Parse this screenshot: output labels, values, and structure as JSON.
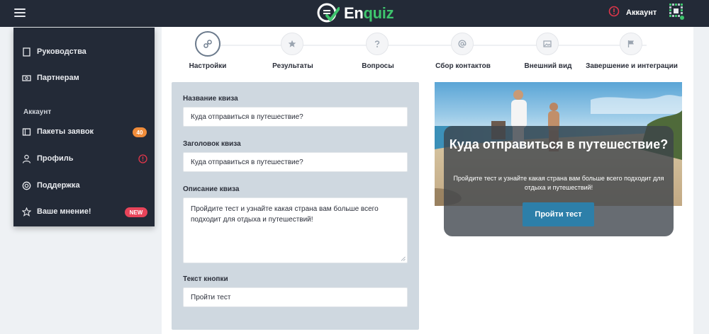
{
  "topbar": {
    "logo_prefix": "En",
    "logo_suffix": "quiz",
    "account_label": "Аккаунт"
  },
  "sidebar": {
    "items": [
      {
        "label": "Руководства",
        "icon": "document-icon"
      },
      {
        "label": "Партнерам",
        "icon": "money-icon"
      }
    ],
    "section_title": "Аккаунт",
    "account_items": [
      {
        "label": "Пакеты заявок",
        "icon": "package-icon",
        "badge": "40"
      },
      {
        "label": "Профиль",
        "icon": "user-icon",
        "badge_icon": "alert-icon"
      },
      {
        "label": "Поддержка",
        "icon": "lifebuoy-icon"
      },
      {
        "label": "Ваше мнение!",
        "icon": "star-icon",
        "badge": "NEW"
      }
    ]
  },
  "stepper": {
    "steps": [
      {
        "label": "Настройки",
        "icon": "link-icon",
        "active": true
      },
      {
        "label": "Результаты",
        "icon": "star-icon",
        "active": false
      },
      {
        "label": "Вопросы",
        "icon": "question-icon",
        "active": false
      },
      {
        "label": "Сбор контактов",
        "icon": "at-icon",
        "active": false
      },
      {
        "label": "Внешний вид",
        "icon": "image-icon",
        "active": false
      },
      {
        "label": "Завершение и интеграции",
        "icon": "flag-icon",
        "active": false
      }
    ]
  },
  "form": {
    "quiz_name_label": "Название квиза",
    "quiz_name_value": "Куда отправиться в путешествие?",
    "quiz_heading_label": "Заголовок квиза",
    "quiz_heading_value": "Куда отправиться в путешествие?",
    "quiz_description_label": "Описание квиза",
    "quiz_description_value": "Пройдите тест и узнайте какая страна вам больше всего подходит для отдыха и путешествий!",
    "button_text_label": "Текст кнопки",
    "button_text_value": "Пройти тест"
  },
  "preview": {
    "title": "Куда отправиться в путешествие?",
    "description": "Пройдите тест и узнайте какая страна вам больше всего подходит для отдыха и путешествий!",
    "button_label": "Пройти тест"
  },
  "colors": {
    "topbar_bg": "#232a37",
    "brand_green": "#3ec46d",
    "badge_orange": "#f08c3a",
    "badge_red": "#e8445a",
    "alert_red": "#e0364a",
    "cta_blue": "#2d7fa9",
    "form_bg": "#cfd8e0"
  }
}
